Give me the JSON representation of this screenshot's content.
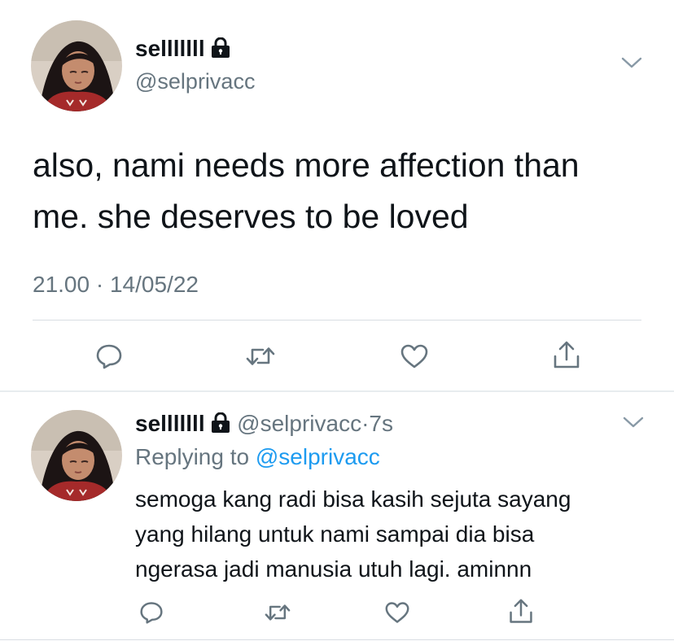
{
  "main_tweet": {
    "display_name": "selllllll",
    "handle": "@selprivacc",
    "text_line1": "also, nami needs more affection than",
    "text_line2": "me. she deserves to be loved",
    "time": "21.00",
    "separator": "·",
    "date": "14/05/22"
  },
  "reply_tweet": {
    "display_name": "selllllll",
    "handle": "@selprivacc",
    "separator": "·",
    "age": "7s",
    "replying_prefix": "Replying to",
    "replying_handle": "@selprivacc",
    "text_line1": "semoga kang radi bisa kasih sejuta sayang",
    "text_line2": "yang hilang untuk nami sampai dia bisa",
    "text_line3": "ngerasa jadi manusia utuh lagi. aminnn"
  },
  "icons": {
    "lock": "lock-icon",
    "chevron": "chevron-down-icon",
    "reply": "reply-icon",
    "retweet": "retweet-icon",
    "like": "heart-icon",
    "share": "share-icon"
  },
  "colors": {
    "text": "#0f1419",
    "secondary": "#66757f",
    "link": "#1d9bf0",
    "divider": "#d8dde2"
  }
}
